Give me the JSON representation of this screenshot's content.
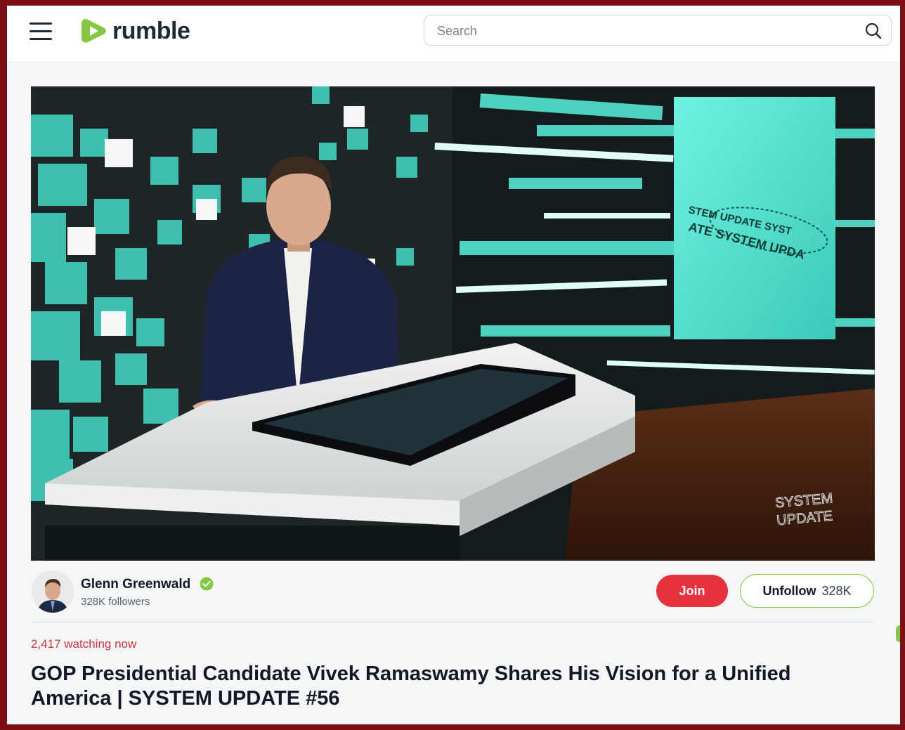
{
  "header": {
    "logo_text": "rumble",
    "search_placeholder": "Search",
    "menu_icon": "hamburger-menu-icon",
    "search_icon": "search-icon"
  },
  "video": {
    "screen_text_ring_top": "STEM UPDATE SYST",
    "screen_text_ring_bottom": "ATE SYSTEM UPDA",
    "watermark_line1": "SYSTEM",
    "watermark_line2": "UPDATE"
  },
  "channel": {
    "name": "Glenn Greenwald",
    "verified_icon": "verified-check-icon",
    "followers": "328K followers",
    "join_label": "Join",
    "unfollow_label": "Unfollow",
    "unfollow_count": "328K"
  },
  "stream": {
    "watching": "2,417 watching now",
    "title": "GOP Presidential Candidate Vivek Ramaswamy Shares His Vision for a Unified America | SYSTEM UPDATE #56"
  },
  "colors": {
    "brand_green": "#85c742",
    "join_red": "#e5323e",
    "watching_red": "#d0323c",
    "frame_border": "#7a1016",
    "studio_teal": "#4fd1c0"
  }
}
